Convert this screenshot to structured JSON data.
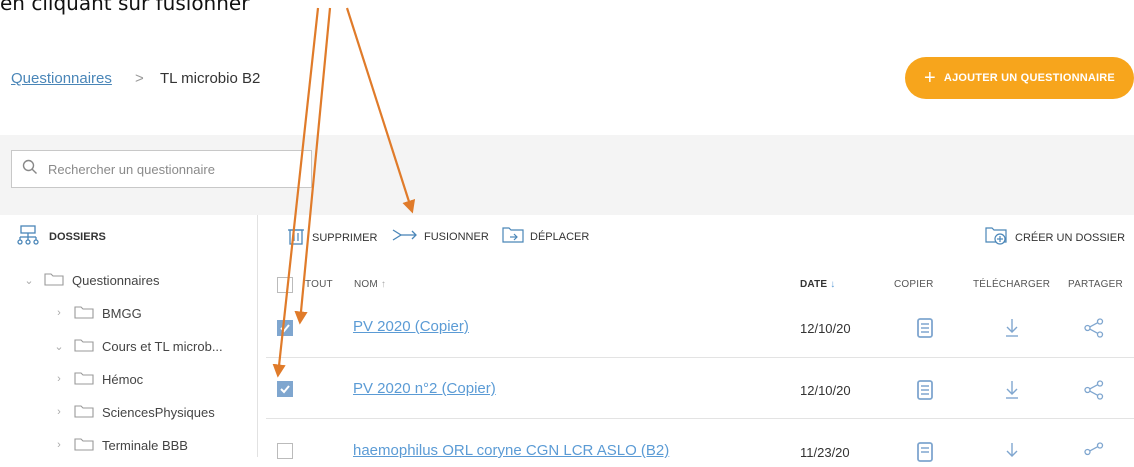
{
  "caption": "en cliquant sur fusionner",
  "breadcrumb": {
    "root": "Questionnaires",
    "separator": ">",
    "current": "TL microbio B2"
  },
  "add_button": {
    "icon": "plus-icon",
    "label": "AJOUTER UN QUESTIONNAIRE"
  },
  "search": {
    "placeholder": "Rechercher un questionnaire"
  },
  "sidebar": {
    "header": "DOSSIERS",
    "items": [
      {
        "label": "Questionnaires",
        "expanded": true
      },
      {
        "label": "BMGG",
        "expanded": false
      },
      {
        "label": "Cours et TL microb...",
        "expanded": true
      },
      {
        "label": "Hémoc",
        "expanded": false
      },
      {
        "label": "SciencesPhysiques",
        "expanded": false
      },
      {
        "label": "Terminale BBB",
        "expanded": false
      }
    ]
  },
  "actions": {
    "delete": "SUPPRIMER",
    "merge": "FUSIONNER",
    "move": "DÉPLACER",
    "create_folder": "CRÉER UN DOSSIER"
  },
  "table": {
    "headers": {
      "all": "TOUT",
      "name": "NOM",
      "date": "DATE",
      "copy": "COPIER",
      "download": "TÉLÉCHARGER",
      "share": "PARTAGER"
    },
    "rows": [
      {
        "name": "PV 2020 (Copier)",
        "date": "12/10/20",
        "checked": true
      },
      {
        "name": "PV 2020 n°2 (Copier)",
        "date": "12/10/20",
        "checked": true
      },
      {
        "name": "haemophilus ORL coryne CGN LCR ASLO (B2)",
        "date": "11/23/20",
        "checked": false
      }
    ]
  },
  "colors": {
    "accent": "#f7a51c",
    "link": "#5b9bd5",
    "icon": "#7fa6cf",
    "annotation_arrow": "#e07b2a"
  }
}
